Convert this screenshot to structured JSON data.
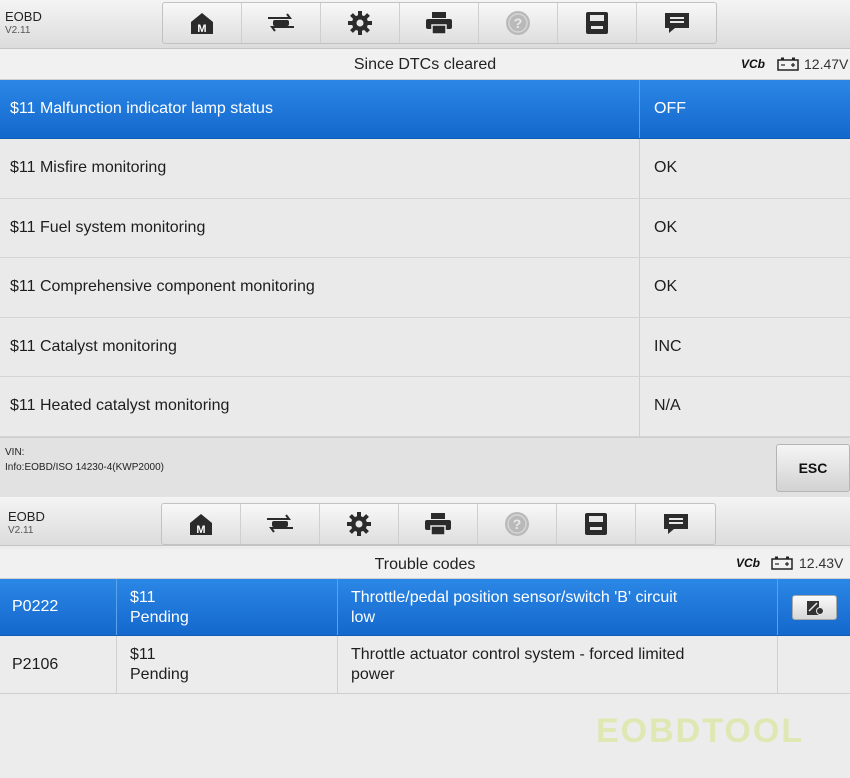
{
  "screen1": {
    "app": {
      "name": "EOBD",
      "version": "V2.11"
    },
    "toolbar": [
      "home-icon",
      "vehicle-swap-icon",
      "gear-icon",
      "printer-icon",
      "help-icon",
      "save-icon",
      "message-icon"
    ],
    "title": "Since DTCs cleared",
    "status": {
      "vci": "VCb",
      "voltage": "12.47V"
    },
    "rows": [
      {
        "label": "$11 Malfunction indicator lamp status",
        "value": "OFF",
        "selected": true
      },
      {
        "label": "$11 Misfire monitoring",
        "value": "OK"
      },
      {
        "label": "$11 Fuel system monitoring",
        "value": "OK"
      },
      {
        "label": "$11 Comprehensive component monitoring",
        "value": "OK"
      },
      {
        "label": "$11 Catalyst monitoring",
        "value": "INC"
      },
      {
        "label": "$11 Heated catalyst monitoring",
        "value": "N/A"
      }
    ],
    "footer": {
      "vin": "VIN:",
      "info": "Info:EOBD/ISO 14230-4(KWP2000)",
      "esc_label": "ESC"
    }
  },
  "screen2": {
    "app": {
      "name": "EOBD",
      "version": "V2.11"
    },
    "title": "Trouble codes",
    "status": {
      "vci": "VCb",
      "voltage": "12.43V"
    },
    "dtcs": [
      {
        "code": "P0222",
        "mode": "$11",
        "state": "Pending",
        "desc1": "Throttle/pedal position sensor/switch 'B' circuit",
        "desc2": "low",
        "selected": true
      },
      {
        "code": "P2106",
        "mode": "$11",
        "state": "Pending",
        "desc1": "Throttle actuator control system - forced limited",
        "desc2": "power"
      }
    ]
  },
  "watermark": "EOBDTOOL",
  "colors": {
    "selected": "#1f78dc",
    "background": "#ebebeb"
  }
}
